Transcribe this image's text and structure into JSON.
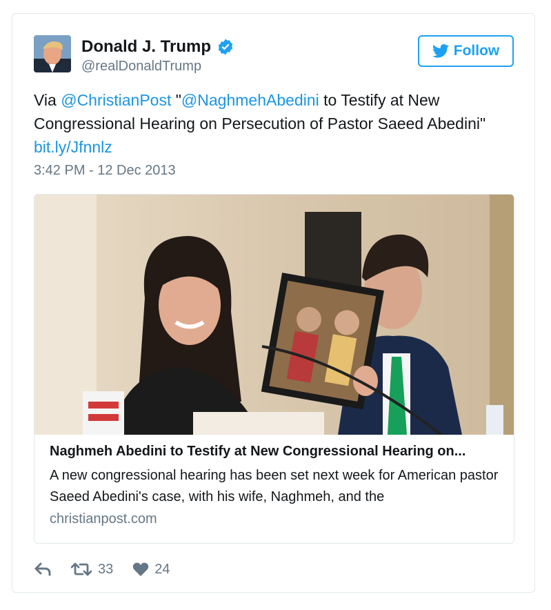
{
  "user": {
    "display_name": "Donald J. Trump",
    "handle": "@realDonaldTrump",
    "verified": true
  },
  "follow_label": "Follow",
  "tweet": {
    "prefix": "Via ",
    "mention1": "@ChristianPost",
    "quote_open": " \"",
    "mention2": "@NaghmehAbedini",
    "body_rest": " to Testify at New Congressional Hearing on Persecution of Pastor Saeed Abedini\"",
    "link": "bit.ly/Jfnnlz"
  },
  "timestamp": "3:42 PM - 12 Dec 2013",
  "card": {
    "title": "Naghmeh Abedini to Testify at New Congressional Hearing on...",
    "description": "A new congressional hearing has been set next week for American pastor Saeed Abedini's case, with his wife, Naghmeh, and the",
    "domain": "christianpost.com"
  },
  "actions": {
    "retweet_count": "33",
    "like_count": "24"
  },
  "colors": {
    "link": "#1b95e0",
    "secondary": "#657786",
    "border": "#e1e8ed",
    "accent": "#1da1f2"
  },
  "icons": [
    "verified-badge-icon",
    "twitter-bird-icon",
    "reply-icon",
    "retweet-icon",
    "heart-icon"
  ]
}
